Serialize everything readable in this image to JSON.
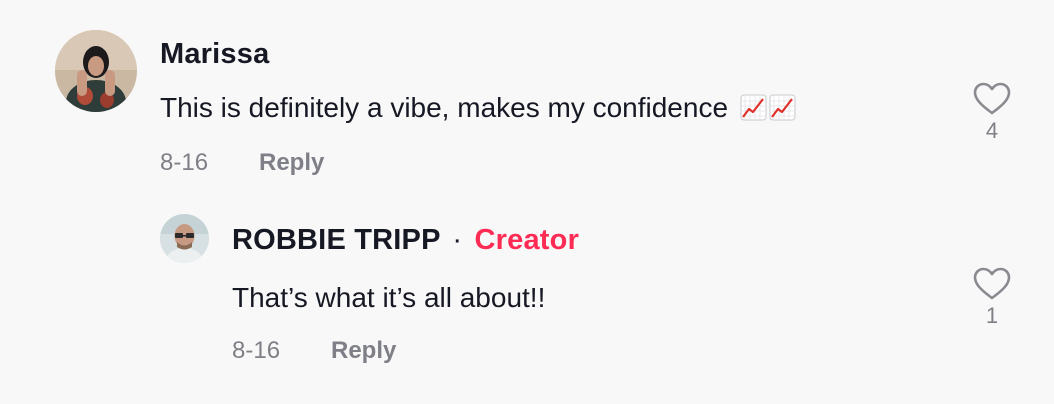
{
  "comments": [
    {
      "username": "Marissa",
      "text": "This is definitely a vibe, makes my confidence",
      "emoji": [
        "chart-increasing-icon",
        "chart-increasing-icon"
      ],
      "date": "8-16",
      "reply_label": "Reply",
      "likes": "4"
    },
    {
      "username": "ROBBIE TRIPP",
      "separator": "·",
      "badge": "Creator",
      "text": "That’s what it’s all about!!",
      "date": "8-16",
      "reply_label": "Reply",
      "likes": "1"
    }
  ],
  "colors": {
    "background": "#f8f8f8",
    "text": "#161823",
    "muted": "#7f8087",
    "creator_accent": "#fe2c55"
  }
}
